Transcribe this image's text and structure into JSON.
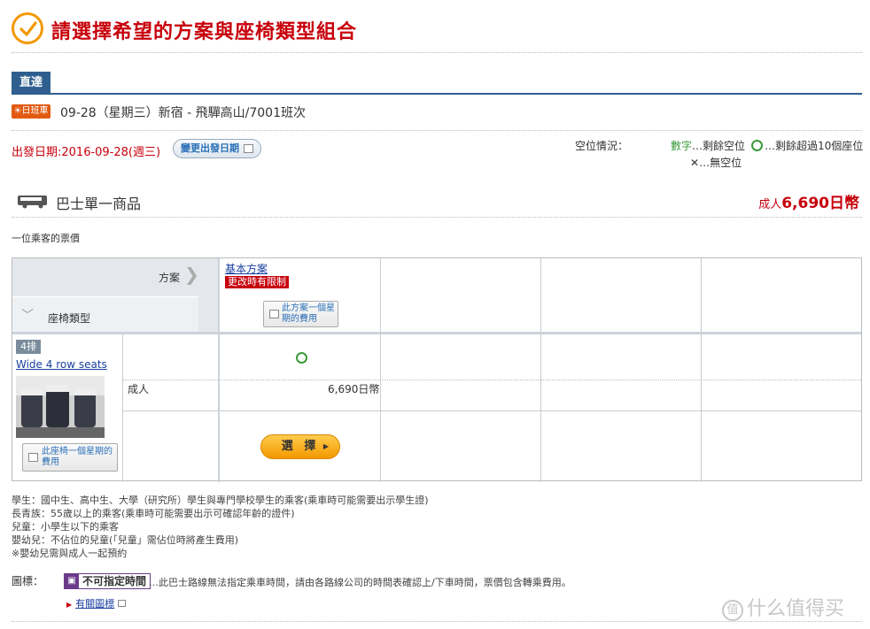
{
  "header": {
    "title": "請選擇希望的方案與座椅類型組合"
  },
  "route_tab": {
    "label": "直達"
  },
  "trip": {
    "badge": "☀日班車",
    "text": "09-28（星期三）新宿 - 飛驒高山/7001班次"
  },
  "departure": {
    "label": "出發日期:2016-09-28(週三)",
    "change_button": "變更出發日期"
  },
  "seat_status": {
    "label": "空位情況：",
    "number_legend_highlight": "數字",
    "number_legend_text": "…剩餘空位",
    "circle_legend_text": "…剩餘超過10個座位",
    "x_legend_mark": "✕",
    "x_legend_text": "…無空位"
  },
  "product": {
    "name": "巴士單一商品",
    "price_label": "成人",
    "price_value": "6,690日幣"
  },
  "per_person_label": "一位乘客的票價",
  "grid": {
    "plan_header": "方案",
    "seat_type_header": "座椅類型",
    "plan": {
      "name": "基本方案",
      "restriction": "更改時有限制",
      "week_button": "此方案一個星期的費用"
    },
    "seat": {
      "rows_badge": "4排",
      "name": "Wide 4 row seats",
      "week_button": "此座椅一個星期的費用"
    },
    "fare": {
      "passenger_type": "成人",
      "price": "6,690日幣"
    },
    "select_button": "選 擇",
    "select_arrow": "▶"
  },
  "notes": [
    "學生：國中生、高中生、大學（研究所）學生與專門學校學生的乘客(乘車時可能需要出示學生證)",
    "長青族：55歲以上的乘客(乘車時可能需要出示可確認年齡的證件)",
    "兒童：小學生以下的乘客",
    "嬰幼兒：不佔位的兒童(「兒童」需佔位時將產生費用)",
    "※嬰幼兒需與成人一起預約"
  ],
  "icons_section": {
    "label": "圖標：",
    "no_time_badge": "不可指定時間",
    "no_time_icon": "bus-icon",
    "no_time_desc": "…此巴士路線無法指定乘車時間，請由各路線公司的時間表確認上/下車時間，票價包含轉乘費用。",
    "link_text": "有關圖標"
  },
  "watermark": {
    "mark": "值",
    "text": "什么值得买"
  },
  "colors": {
    "accent_red": "#c7000b",
    "nav_blue": "#2f5f8f",
    "orange": "#f39800",
    "green": "#3a9a3a",
    "purple": "#6b3a8a"
  }
}
